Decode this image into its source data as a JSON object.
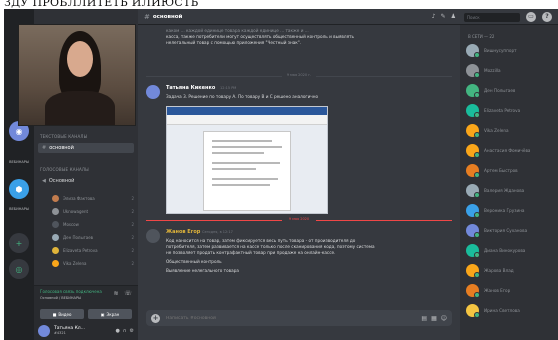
{
  "caption": "ЗДУ ПРОБЛЛИТЕТЬ ИЛИЮСТЬ",
  "channel": {
    "hash": "#",
    "name": "основной"
  },
  "colors": {
    "accent": "#7289da",
    "online": "#43b581",
    "unread": "#f04747",
    "background": "#36393f"
  },
  "rail": {
    "items": [
      {
        "icon": "home-icon",
        "color": "#7289da",
        "label": ""
      },
      {
        "icon": "server-icon",
        "color": "#43b581",
        "label": "ВЕБИНАРЫ"
      },
      {
        "icon": "server-icon",
        "color": "#3aa0e8",
        "label": "ВЕБИНАРЫ"
      },
      {
        "icon": "add-server-icon",
        "color": "#36393f",
        "label": ""
      },
      {
        "icon": "explore-icon",
        "color": "#36393f",
        "label": ""
      }
    ]
  },
  "sidebar": {
    "text_category": "ТЕКСТОВЫЕ КАНАЛЫ",
    "text_channel": "основной",
    "voice_category": "ГОЛОСОВЫЕ КАНАЛЫ",
    "voice_channel": "Основной",
    "voice_users": [
      {
        "name": "Элиза Фактова",
        "color": "#c27c4e",
        "count": "2"
      },
      {
        "name": "Uknowagent",
        "color": "#8e9297",
        "count": "2"
      },
      {
        "name": "Moscow",
        "color": "#4f545c",
        "count": "2"
      },
      {
        "name": "Ден Полыгаев",
        "color": "#99aab5",
        "count": "2"
      },
      {
        "name": "Elizaveta Petrova",
        "color": "#e0b43a",
        "count": "2"
      },
      {
        "name": "Vika Zelena",
        "color": "#faa61a",
        "count": "2"
      }
    ],
    "voice_connected": "Голосовая связь подключена",
    "voice_location": "Основной / ВЕБИНАРЫ",
    "video_button": "Видео",
    "screen_button": "Экран",
    "user_name": "Татьяна Кл...",
    "user_tag": "#4321"
  },
  "messages": {
    "top_text": [
      "каком ... каждой единице товара каждой единице ... также и ...",
      "касса, также потребители могут осуществлять общественный контроль и выявлять",
      "нелегальный товар с помощью приложения \"Честный знак\"."
    ],
    "date_1": "9 мая 2020 г.",
    "m1": {
      "author": "Татьяна Кикенко",
      "time": "12:15 PM",
      "text": "Задача 3. Решение по товару А. По товару В и С решено аналогично"
    },
    "new_divider": "9 мая 2020",
    "m2": {
      "author": "Жанов Егор",
      "time": "Сегодня, в 12:17",
      "text": [
        "Код наносится на товар, затем фиксируется весь путь товара - от производителя до",
        "потребителя, затем развивается на кассе только после сканирования кода, поэтому система",
        "не позволяет продать контрафактный товар при продаже на онлайн-кассе.",
        "Общественный контроль",
        "Выявление нелегального товара"
      ]
    }
  },
  "composer": {
    "placeholder": "Написать #основной"
  },
  "members": {
    "search_placeholder": "Поиск",
    "heading": "В СЕТИ — 22",
    "list": [
      {
        "name": "Вишнусуппорт",
        "color": "#99aab5"
      },
      {
        "name": "Mozzilla",
        "color": "#8e9297"
      },
      {
        "name": "Ден Полыгаев",
        "color": "#43b581"
      },
      {
        "name": "Elizaveta Petrova",
        "color": "#1abc9c"
      },
      {
        "name": "Vika Zelena",
        "color": "#faa61a"
      },
      {
        "name": "Анастасия Фомичёва",
        "color": "#faa61a"
      },
      {
        "name": "Артем Быстров",
        "color": "#e67e22"
      },
      {
        "name": "Валерия Жданова",
        "color": "#99aab5"
      },
      {
        "name": "Вероника Грузина",
        "color": "#3aa0e8"
      },
      {
        "name": "Виктория Суханова",
        "color": "#7289da"
      },
      {
        "name": "Диана Винокурова",
        "color": "#1abc9c"
      },
      {
        "name": "Жарова Влад",
        "color": "#faa61a"
      },
      {
        "name": "Жанов Егор",
        "color": "#e67e22"
      },
      {
        "name": "Ирина Светлова",
        "color": "#f5c542"
      }
    ]
  }
}
